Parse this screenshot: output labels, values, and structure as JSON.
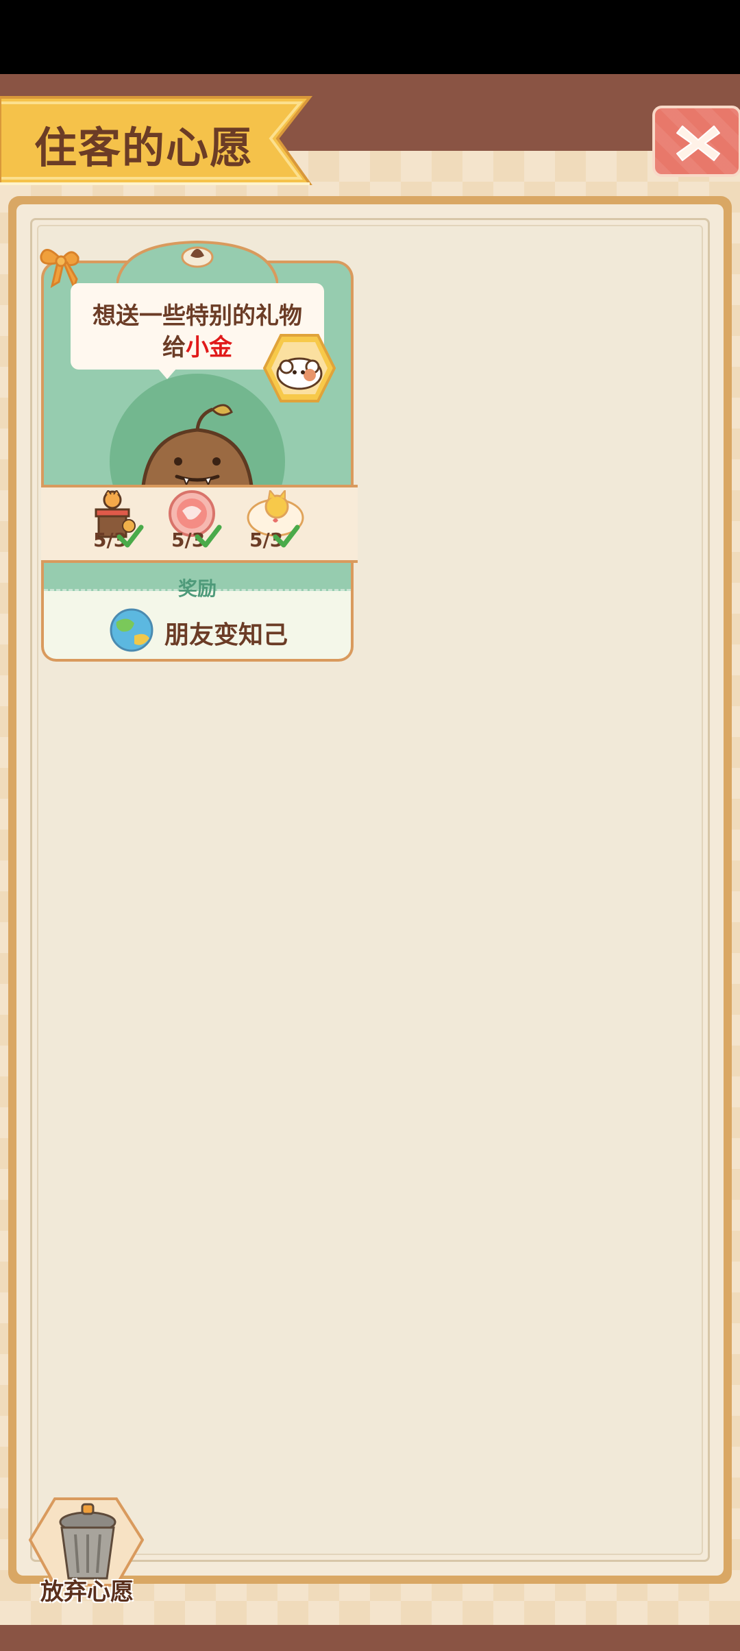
{
  "header": {
    "title": "住客的心愿"
  },
  "close_button": {
    "icon": "close-x-icon"
  },
  "wish_card": {
    "message_line1": "想送一些特别的礼物",
    "message_line2_prefix": "给",
    "message_line2_name": "小金",
    "items": [
      {
        "icon": "flower-pot-gift-icon",
        "count": "5/3"
      },
      {
        "icon": "pink-cake-gift-icon",
        "count": "5/3"
      },
      {
        "icon": "cat-cushion-gift-icon",
        "count": "5/3"
      }
    ],
    "reward_label": "奖励",
    "reward_text": "朋友变知己"
  },
  "abandon_button": {
    "label": "放弃心愿"
  },
  "colors": {
    "accent_brown": "#6b3c26",
    "highlight_red": "#e01a1a",
    "card_green": "#96ccaf",
    "frame_gold": "#d9a764"
  }
}
